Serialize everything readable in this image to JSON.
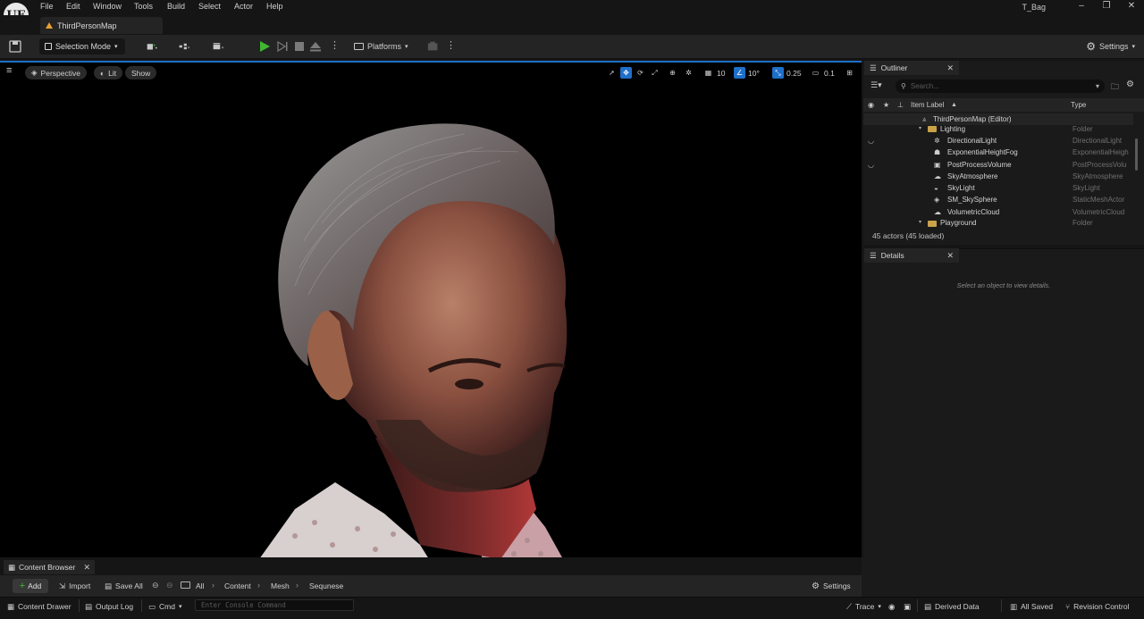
{
  "menu": {
    "items": [
      "File",
      "Edit",
      "Window",
      "Tools",
      "Build",
      "Select",
      "Actor",
      "Help"
    ]
  },
  "window": {
    "project_name": "T_Bag",
    "logo": "UE"
  },
  "level_tab": {
    "label": "ThirdPersonMap"
  },
  "toolbar": {
    "selection_mode": "Selection Mode",
    "platforms": "Platforms",
    "settings": "Settings"
  },
  "viewport": {
    "perspective": "Perspective",
    "lit": "Lit",
    "show": "Show",
    "grid_size": "10",
    "rotation_snap": "10°",
    "scale_snap": "0.25",
    "camera_speed": "0.1"
  },
  "outliner": {
    "title": "Outliner",
    "search_placeholder": "Search...",
    "col_label": "Item Label",
    "col_type": "Type",
    "rows": [
      {
        "label": "ThirdPersonMap (Editor)",
        "type": "",
        "icon": "level-icon"
      },
      {
        "label": "Lighting",
        "type": "Folder",
        "icon": "folder-icon"
      },
      {
        "label": "DirectionalLight",
        "type": "DirectionalLight",
        "icon": "sun-icon"
      },
      {
        "label": "ExponentialHeightFog",
        "type": "ExponentialHeigh",
        "icon": "fog-icon"
      },
      {
        "label": "PostProcessVolume",
        "type": "PostProcessVolu",
        "icon": "volume-icon"
      },
      {
        "label": "SkyAtmosphere",
        "type": "SkyAtmosphere",
        "icon": "atmosphere-icon"
      },
      {
        "label": "SkyLight",
        "type": "SkyLight",
        "icon": "skylight-icon"
      },
      {
        "label": "SM_SkySphere",
        "type": "StaticMeshActor",
        "icon": "mesh-icon"
      },
      {
        "label": "VolumetricCloud",
        "type": "VolumetricCloud",
        "icon": "cloud-icon"
      },
      {
        "label": "Playground",
        "type": "Folder",
        "icon": "folder-icon"
      }
    ],
    "actor_count": "45 actors (45 loaded)"
  },
  "details": {
    "title": "Details",
    "hint": "Select an object to view details."
  },
  "content_browser": {
    "tab": "Content Browser",
    "add": "Add",
    "import": "Import",
    "save_all": "Save All",
    "breadcrumbs": [
      "All",
      "Content",
      "Mesh",
      "Sequnese"
    ],
    "settings": "Settings"
  },
  "statusbar": {
    "content_drawer": "Content Drawer",
    "output_log": "Output Log",
    "cmd": "Cmd",
    "console_placeholder": "Enter Console Command",
    "trace": "Trace",
    "derived_data": "Derived Data",
    "all_saved": "All Saved",
    "revision_control": "Revision Control"
  },
  "colors": {
    "accent_blue": "#1e6fc9",
    "play_green": "#3fb531",
    "folder": "#c9a24a"
  }
}
